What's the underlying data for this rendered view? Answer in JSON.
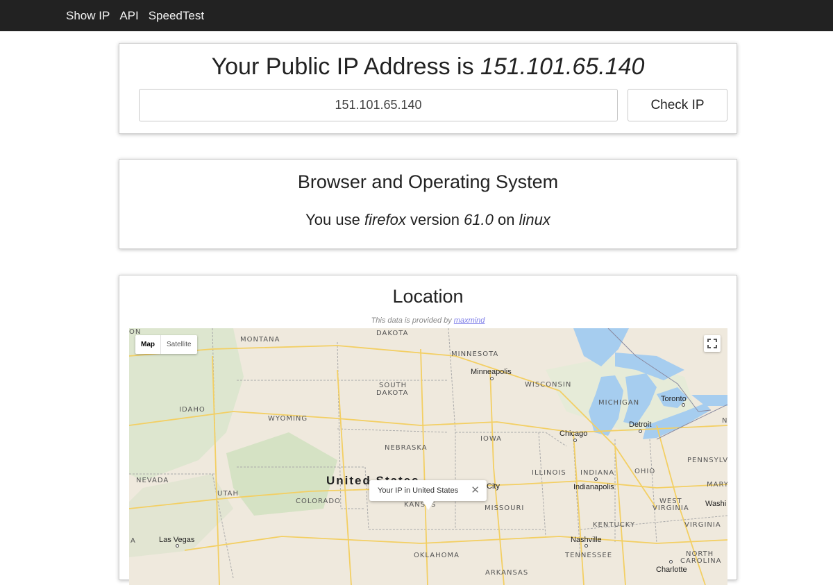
{
  "nav": {
    "items": [
      "Show IP",
      "API",
      "SpeedTest"
    ]
  },
  "ip_card": {
    "heading_prefix": "Your Public IP Address is ",
    "heading_ip": "151.101.65.140",
    "input_value": "151.101.65.140",
    "check_button": "Check IP"
  },
  "browser_card": {
    "title": "Browser and Operating System",
    "prefix": "You use ",
    "browser": "firefox",
    "version_word": " version ",
    "version": "61.0",
    "on_word": " on ",
    "os": "linux"
  },
  "location_card": {
    "title": "Location",
    "provided_prefix": "This data is provided by ",
    "provider": "maxmind",
    "map": {
      "type_map": "Map",
      "type_satellite": "Satellite",
      "popup_text": "Your IP in United States",
      "popup_close": "✕",
      "country_label": "United States",
      "states": {
        "dakota": "DAKOTA",
        "montana": "MONTANA",
        "minnesota": "MINNESOTA",
        "south": "SOUTH",
        "south_dakota": "DAKOTA",
        "wisconsin": "WISCONSIN",
        "michigan": "MICHIGAN",
        "idaho": "IDAHO",
        "wyoming": "WYOMING",
        "iowa": "IOWA",
        "nebraska": "NEBRASKA",
        "nevada": "NEVADA",
        "utah": "UTAH",
        "colorado": "COLORADO",
        "kansas": "KANSAS",
        "missouri": "MISSOURI",
        "illinois": "ILLINOIS",
        "indiana": "INDIANA",
        "ohio": "OHIO",
        "pennsylvania": "PENNSYLV",
        "west": "WEST",
        "virginia_w": "VIRGINIA",
        "virginia": "VIRGINIA",
        "kentucky": "KENTUCKY",
        "tennessee": "TENNESSEE",
        "oklahoma": "OKLAHOMA",
        "north": "NORTH",
        "carolina": "CAROLINA",
        "arkansas": "ARKANSAS",
        "mary": "MARY",
        "edge_on": "ON",
        "edge_a": "A",
        "edge_n": "N"
      },
      "cities": {
        "minneapolis": "Minneapolis",
        "toronto": "Toronto",
        "detroit": "Detroit",
        "chicago": "Chicago",
        "indianapolis": "Indianapolis",
        "city": "City",
        "washi": "Washi",
        "las_vegas": "Las Vegas",
        "nashville": "Nashville",
        "charlotte": "Charlotte"
      }
    }
  }
}
